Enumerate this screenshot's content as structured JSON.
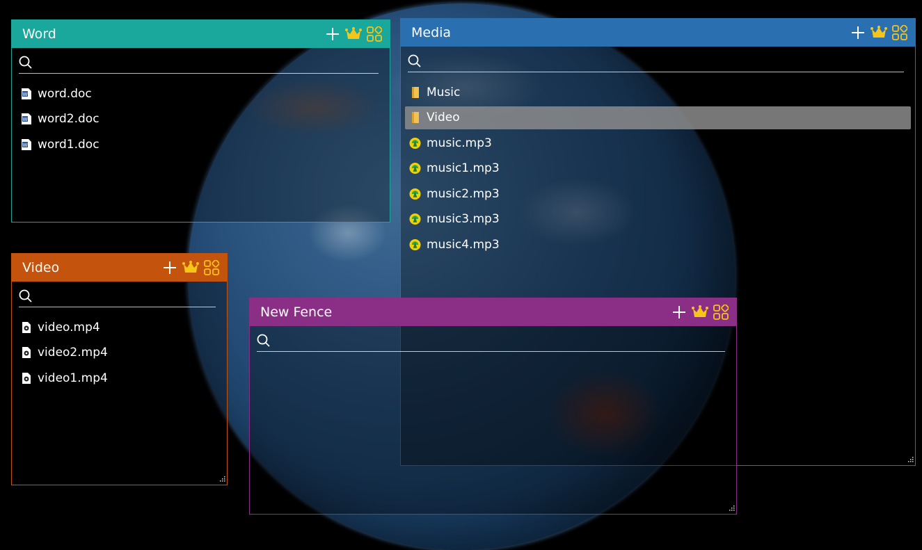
{
  "fences": {
    "word": {
      "title": "Word",
      "color": "#1aa89c",
      "search_placeholder": "",
      "items": [
        {
          "label": "word.doc"
        },
        {
          "label": "word2.doc"
        },
        {
          "label": "word1.doc"
        }
      ]
    },
    "media": {
      "title": "Media",
      "color": "#2a6fb0",
      "search_placeholder": "",
      "items": [
        {
          "label": "Music",
          "type": "folder"
        },
        {
          "label": "Video",
          "type": "folder",
          "selected": true
        },
        {
          "label": "music.mp3",
          "type": "audio"
        },
        {
          "label": "music1.mp3",
          "type": "audio"
        },
        {
          "label": "music2.mp3",
          "type": "audio"
        },
        {
          "label": "music3.mp3",
          "type": "audio"
        },
        {
          "label": "music4.mp3",
          "type": "audio"
        }
      ]
    },
    "video": {
      "title": "Video",
      "color": "#c4530e",
      "search_placeholder": "",
      "items": [
        {
          "label": "video.mp4"
        },
        {
          "label": "video2.mp4"
        },
        {
          "label": "video1.mp4"
        }
      ]
    },
    "new_fence": {
      "title": "New Fence",
      "color": "#8b2f86",
      "search_placeholder": "",
      "items": []
    }
  },
  "icons": {
    "add": "plus-icon",
    "premium": "crown-icon",
    "layout": "grid-icon",
    "search": "search-icon",
    "word_file": "word-file-icon",
    "folder": "folder-icon",
    "audio": "music-file-icon",
    "video_file": "video-file-icon"
  },
  "colors": {
    "crown": "#f5c518",
    "grid": "#f5c518"
  }
}
